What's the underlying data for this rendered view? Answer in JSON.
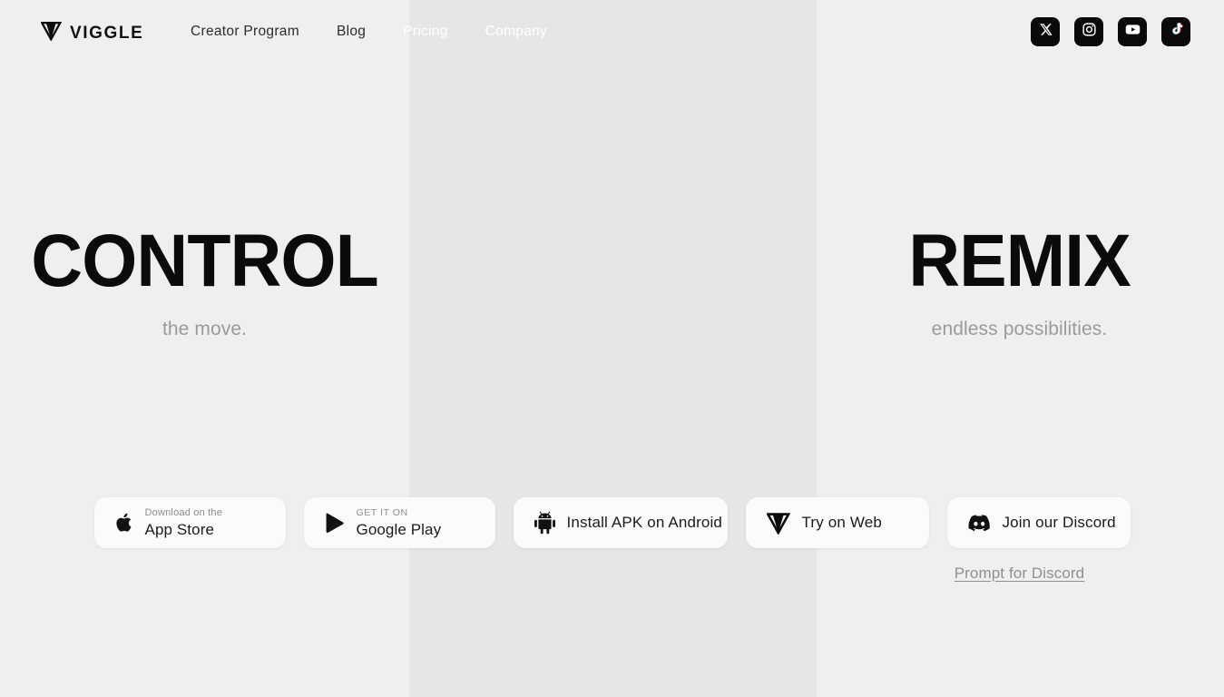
{
  "brand": {
    "name": "VIGGLE",
    "logo_icon": "viggle-v-logo-icon"
  },
  "header": {
    "nav_items": [
      {
        "label": "Creator Program",
        "on_dark": false
      },
      {
        "label": "Blog",
        "on_dark": false
      },
      {
        "label": "Pricing",
        "on_dark": true
      },
      {
        "label": "Company",
        "on_dark": true
      }
    ],
    "socials": [
      {
        "name": "x-twitter-icon",
        "label": "X"
      },
      {
        "name": "instagram-icon",
        "label": "Instagram"
      },
      {
        "name": "youtube-icon",
        "label": "YouTube"
      },
      {
        "name": "tiktok-icon",
        "label": "TikTok"
      }
    ]
  },
  "hero": {
    "left": {
      "title": "CONTROL",
      "subtitle": "the move."
    },
    "right": {
      "title": "REMIX",
      "subtitle": "endless possibilities."
    }
  },
  "cta": {
    "buttons": [
      {
        "id": "appstore",
        "icon": "apple-icon",
        "small_label": "Download on the",
        "big_label": "App Store"
      },
      {
        "id": "googleplay",
        "icon": "google-play-icon",
        "small_label": "GET IT ON",
        "big_label": "Google Play"
      },
      {
        "id": "apk",
        "icon": "android-robot-icon",
        "label": "Install APK on Android"
      },
      {
        "id": "web",
        "icon": "viggle-v-logo-icon",
        "label": "Try on Web"
      },
      {
        "id": "discord",
        "icon": "discord-icon",
        "label": "Join our Discord"
      }
    ],
    "prompt_link": "Prompt for Discord"
  },
  "colors": {
    "panel_light": "#efefef",
    "panel_mid": "#e6e6e6",
    "button_bg": "#fbfbfb",
    "social_bg": "#0a0a0a",
    "heading": "#0b0b0b",
    "subtitle": "#9a9a9a",
    "nav_text": "#2b2b2b",
    "nav_text_on_dark": "#ffffff",
    "link": "#8f8f8f"
  }
}
